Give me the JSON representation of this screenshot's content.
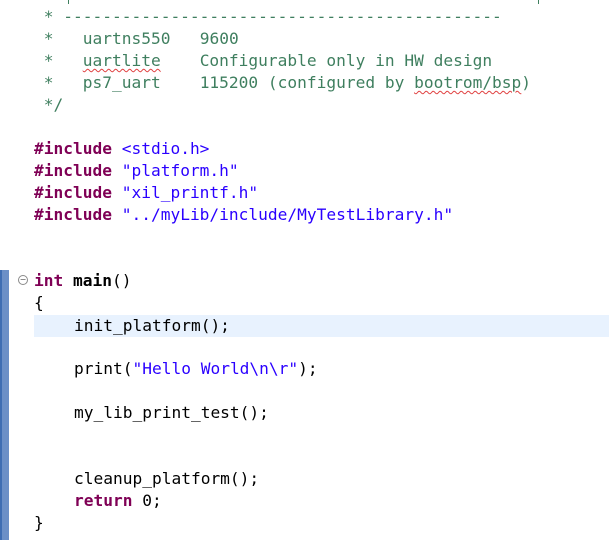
{
  "comment": {
    "dash_line": " * ---------------------------------------------",
    "rows": [
      {
        "star": " *   ",
        "name": "uartns550",
        "pad": "   ",
        "desc_plain": "9600",
        "desc_squiggle": "",
        "desc_tail": ""
      },
      {
        "star": " *   ",
        "name": "uartlite",
        "pad": "    ",
        "desc_plain": "Configurable only in HW design",
        "desc_squiggle": "",
        "desc_tail": ""
      },
      {
        "star": " *   ",
        "name": "ps7_uart",
        "pad": "    ",
        "desc_plain": "115200 (configured by ",
        "desc_squiggle": "bootrom/bsp",
        "desc_tail": ")"
      }
    ],
    "end": " */"
  },
  "includes": [
    {
      "directive": "#include",
      "target": "<stdio.h>"
    },
    {
      "directive": "#include",
      "target": "\"platform.h\""
    },
    {
      "directive": "#include",
      "target": "\"xil_printf.h\""
    },
    {
      "directive": "#include",
      "target": "\"../myLib/include/MyTestLibrary.h\""
    }
  ],
  "main": {
    "return_type": "int",
    "name": "main",
    "params": "()",
    "open_brace": "{",
    "close_brace": "}",
    "stmt_init": "init_platform();",
    "stmt_print_call": "print(",
    "stmt_print_str": "\"Hello World\\n\\r\"",
    "stmt_print_end": ");",
    "stmt_mylib": "my_lib_print_test();",
    "stmt_cleanup": "cleanup_platform();",
    "return_kw": "return",
    "return_val": " 0;"
  },
  "colors": {
    "comment": "#3f7f5f",
    "keyword": "#7f0055",
    "string": "#2a00ff",
    "current_line": "#e8f2fe",
    "gutter_marker": "#6b8fc7"
  },
  "icons": {
    "fold": "collapse-minus-icon"
  }
}
